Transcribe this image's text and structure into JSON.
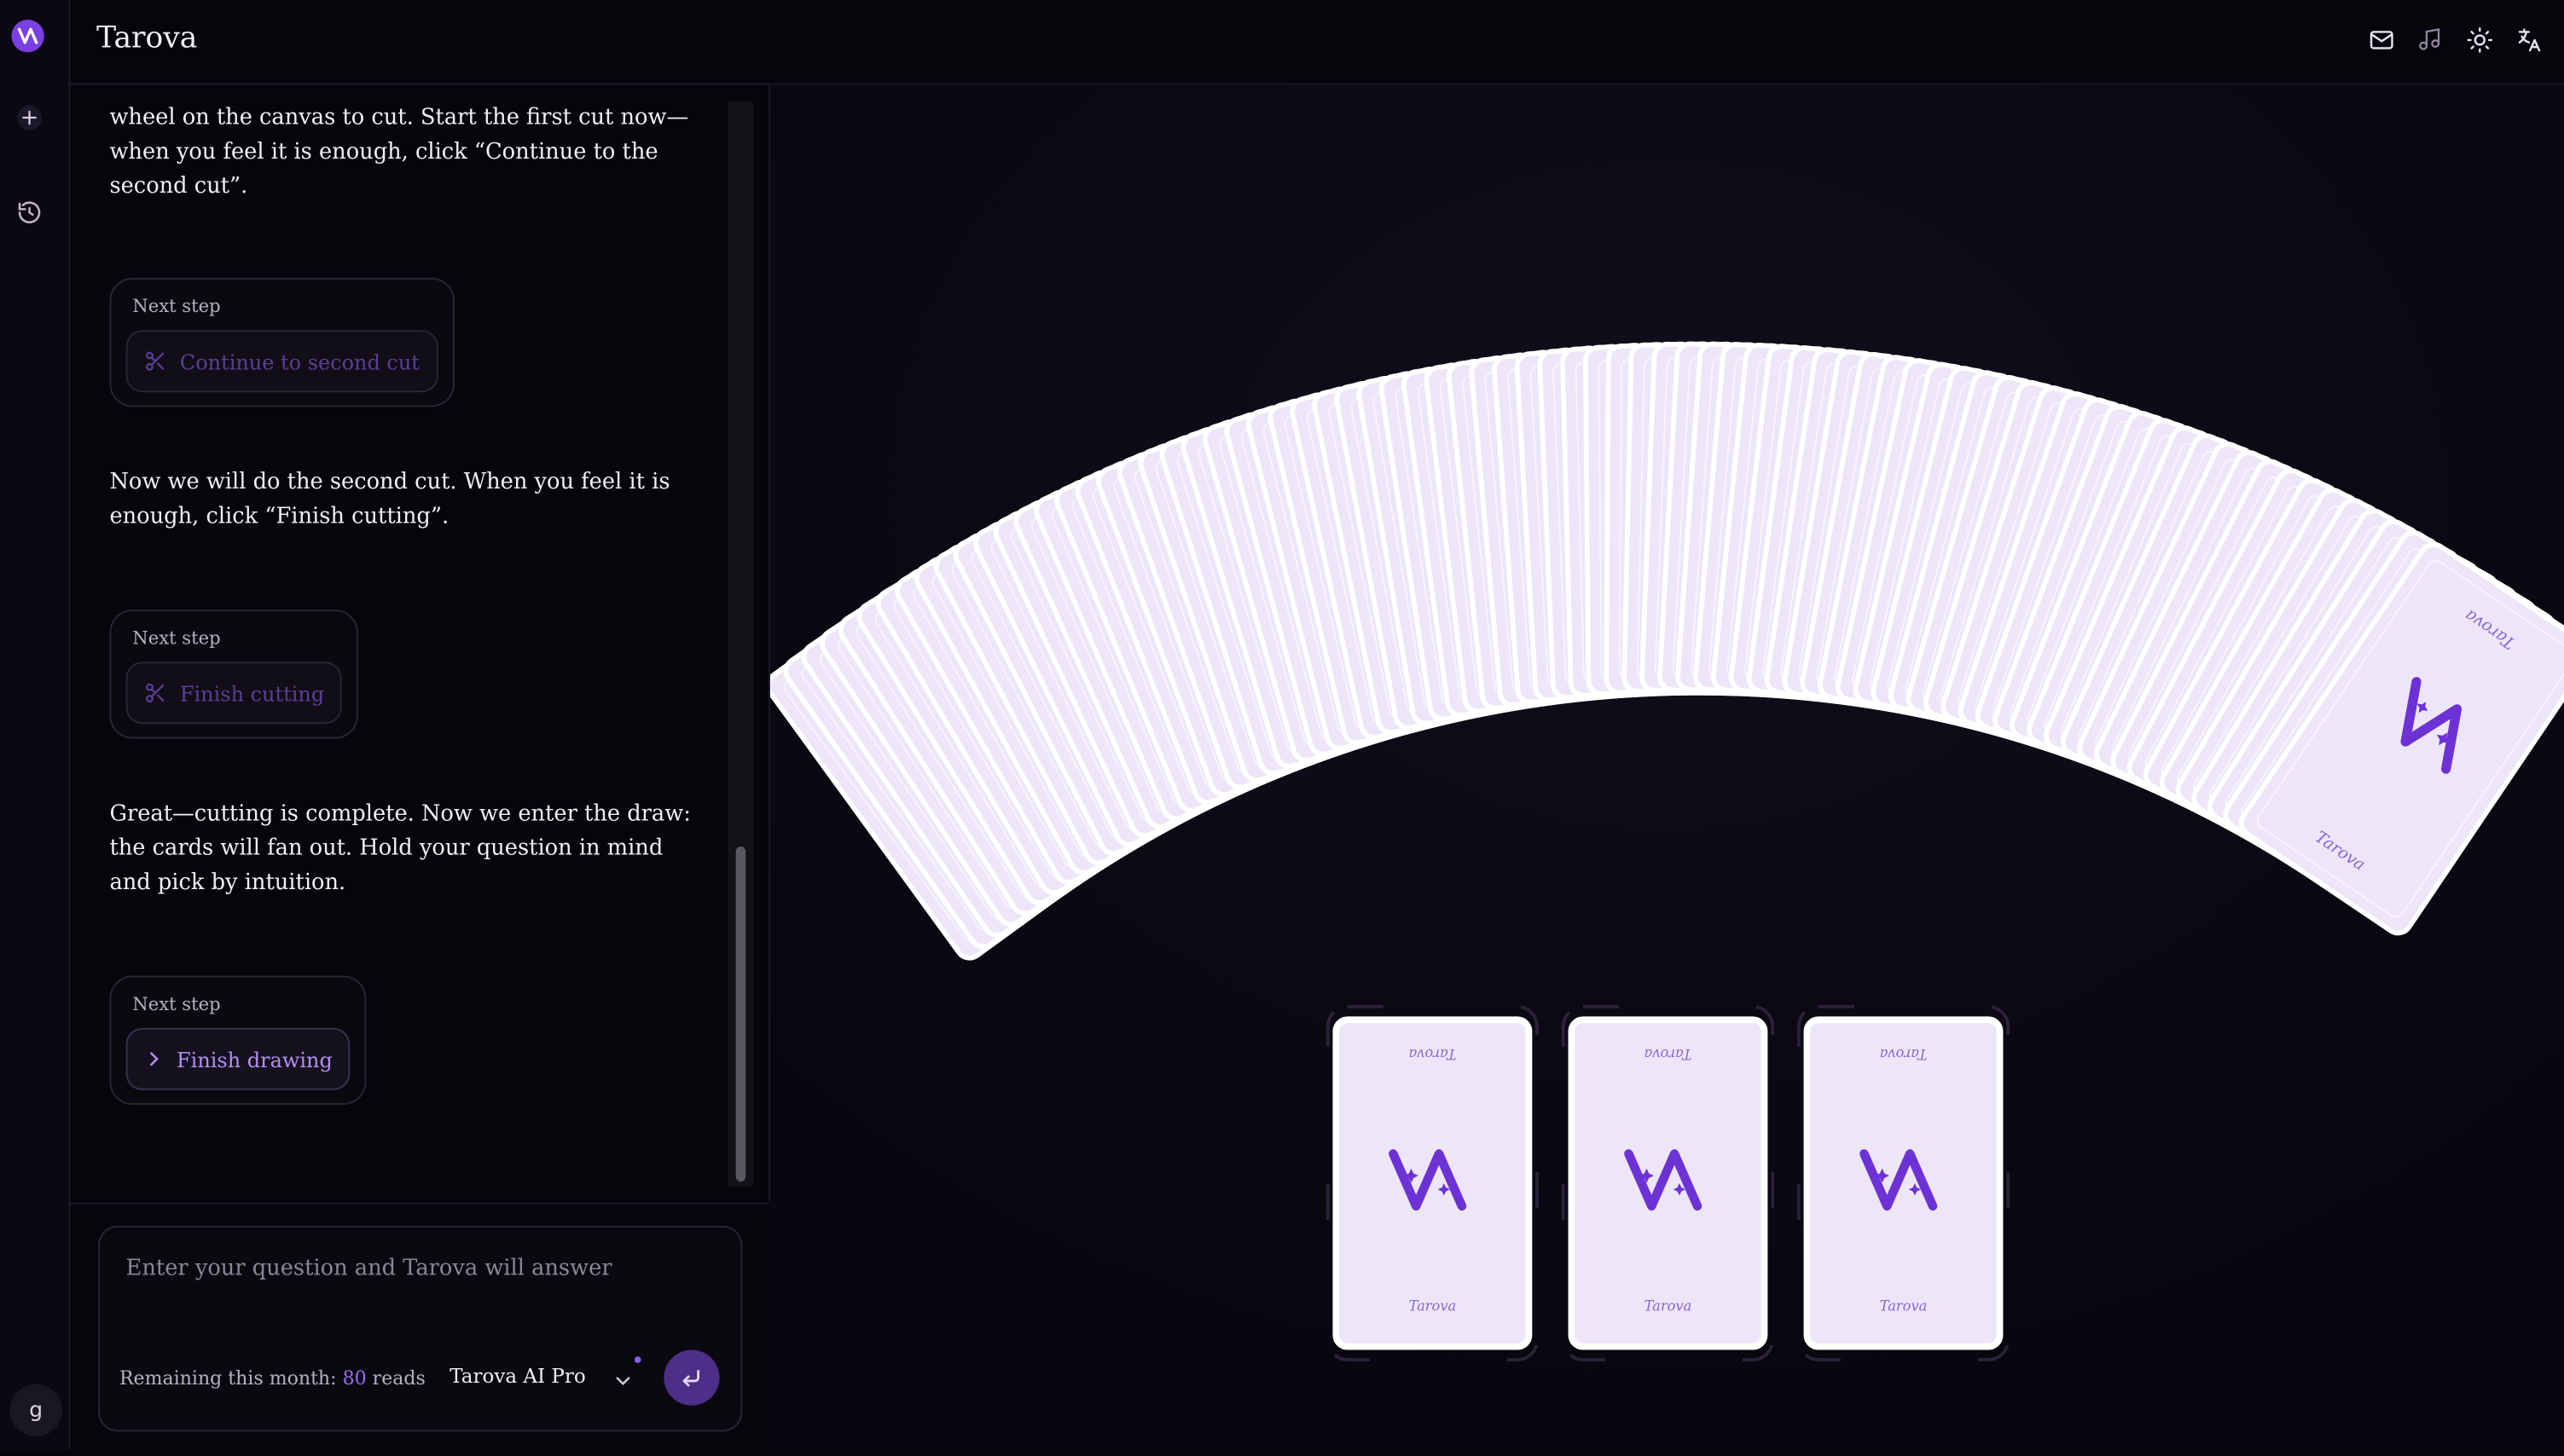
{
  "app": {
    "title": "Tarova"
  },
  "topbar": {
    "icons": [
      "mail-icon",
      "music-icon",
      "sun-icon",
      "translate-icon"
    ]
  },
  "rail": {
    "icons": [
      "logo-icon",
      "plus-icon",
      "history-icon"
    ],
    "avatar_initial": "g"
  },
  "chat": {
    "messages": [
      "wheel on the canvas to cut. Start the first cut now—when you feel it is enough, click “Continue to the second cut”.",
      "Now we will do the second cut. When you feel it is enough, click “Finish cutting”.",
      "Great—cutting is complete. Now we enter the draw: the cards will fan out. Hold your question in mind and pick by intuition."
    ],
    "steps": [
      {
        "label": "Next step",
        "button": "Continue to second cut",
        "icon": "scissors-icon",
        "state": "disabled"
      },
      {
        "label": "Next step",
        "button": "Finish cutting",
        "icon": "scissors-icon",
        "state": "disabled"
      },
      {
        "label": "Next step",
        "button": "Finish drawing",
        "icon": "chevron-right-icon",
        "state": "active"
      }
    ]
  },
  "composer": {
    "placeholder": "Enter your question and Tarova will answer",
    "remaining_label": "Remaining this month:",
    "remaining_count": "80",
    "remaining_unit": "reads",
    "model": "Tarova AI Pro"
  },
  "deck": {
    "card_brand": "Tarova",
    "fan_card_count": 78,
    "drawn_slots": 3,
    "colors": {
      "card_face": "#ede6f8",
      "card_border": "#ffffff",
      "logo": "#6d32d6",
      "brand_text": "#8a63d8"
    }
  }
}
